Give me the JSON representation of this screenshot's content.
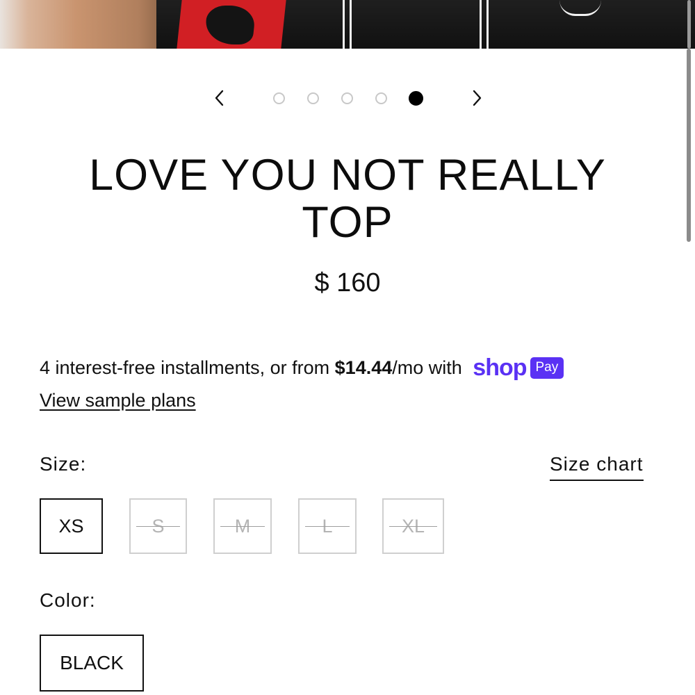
{
  "carousel": {
    "slides": 5,
    "active_index": 4,
    "prev_icon": "chevron-left-icon",
    "next_icon": "chevron-right-icon"
  },
  "product": {
    "title": "LOVE YOU NOT REALLY TOP",
    "price": "$ 160"
  },
  "installments": {
    "text_before": "4 interest-free installments, or from ",
    "amount": "$14.44",
    "text_after": "/mo with ",
    "brand": "shop",
    "badge": "Pay",
    "brand_color": "#5a31f4",
    "link_label": "View sample plans"
  },
  "size": {
    "label": "Size:",
    "chart_link": "Size chart",
    "options": [
      {
        "label": "XS",
        "available": true,
        "selected": true
      },
      {
        "label": "S",
        "available": false,
        "selected": false
      },
      {
        "label": "M",
        "available": false,
        "selected": false
      },
      {
        "label": "L",
        "available": false,
        "selected": false
      },
      {
        "label": "XL",
        "available": false,
        "selected": false
      }
    ]
  },
  "color": {
    "label": "Color:",
    "options": [
      {
        "label": "BLACK",
        "selected": true
      }
    ]
  }
}
